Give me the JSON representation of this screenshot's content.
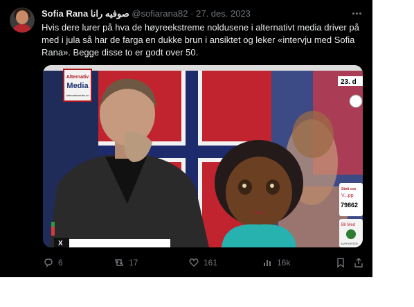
{
  "tweet": {
    "display_name": "Sofia Rana صوفيه رانا",
    "handle": "@sofiarana82",
    "separator": "·",
    "date": "27. des. 2023",
    "text": "Hvis dere lurer på hva de høyreekstreme noldusene i alternativt media driver på med i jula så har de farga en dukke brun i ansiktet og leker «intervju med Sofia Rana». Begge disse to er godt over 50."
  },
  "media": {
    "sign_line1": "Alternativ",
    "sign_line2": "Media",
    "sign_line3": "alternativmedia.no",
    "date_badge": "23. d",
    "side_line1": "Støtt oss",
    "side_line2": "V...pp",
    "side_number": "79862",
    "side_line3": "Bli Med",
    "side_line4": "SUPPORTER",
    "corner_text": "X"
  },
  "actions": {
    "replies": "6",
    "reposts": "17",
    "likes": "161",
    "views": "16k"
  }
}
